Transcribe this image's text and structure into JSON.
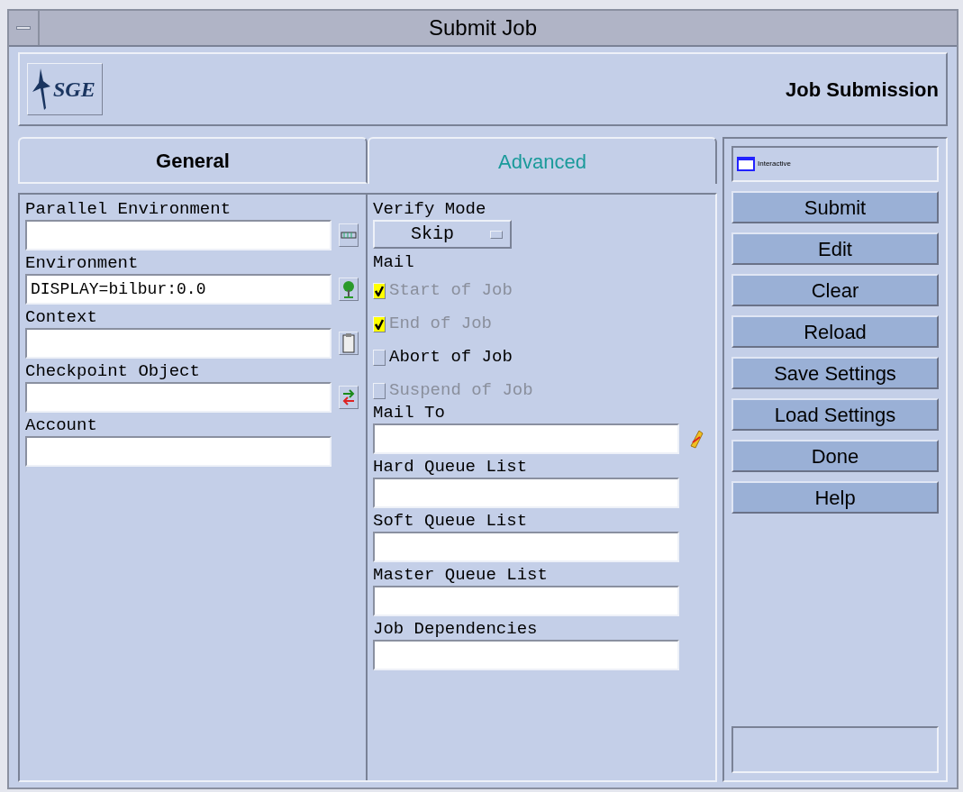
{
  "window": {
    "title": "Submit Job"
  },
  "header": {
    "logo_text": "SGE",
    "title": "Job Submission"
  },
  "tabs": [
    {
      "label": "General",
      "selected": false
    },
    {
      "label": "Advanced",
      "selected": true
    }
  ],
  "left_fields": [
    {
      "label": "Parallel Environment"
    },
    {
      "label": "Environment",
      "value": "DISPLAY=bilbur:0.0"
    },
    {
      "label": "Context"
    },
    {
      "label": "Checkpoint Object"
    },
    {
      "label": "Account"
    }
  ],
  "verify_mode": {
    "label": "Verify Mode",
    "value": "Skip"
  },
  "mail": {
    "label": "Mail",
    "options": [
      {
        "label": "Start of Job",
        "checked": true,
        "disabled": true
      },
      {
        "label": "End of Job",
        "checked": true,
        "disabled": true
      },
      {
        "label": "Abort of Job",
        "checked": false,
        "disabled": false
      },
      {
        "label": "Suspend of Job",
        "checked": false,
        "disabled": true
      }
    ]
  },
  "right_fields": [
    {
      "label": "Mail To"
    },
    {
      "label": "Hard Queue List"
    },
    {
      "label": "Soft Queue List"
    },
    {
      "label": "Master Queue List"
    },
    {
      "label": "Job Dependencies"
    }
  ],
  "job_type": {
    "label": "Interactive"
  },
  "buttons": [
    "Submit",
    "Edit",
    "Clear",
    "Reload",
    "Save Settings",
    "Load Settings",
    "Done",
    "Help"
  ]
}
